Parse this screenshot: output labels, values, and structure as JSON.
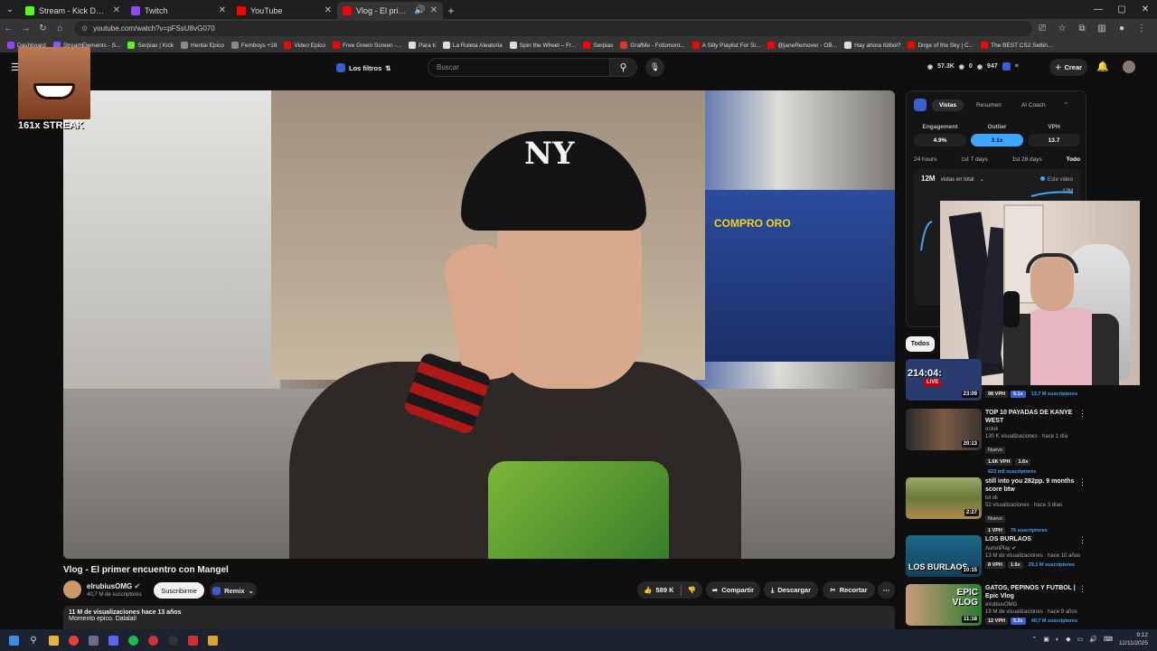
{
  "browser": {
    "tabs": [
      {
        "title": "Stream - Kick Dashboard",
        "color": "#53fc18",
        "active": false
      },
      {
        "title": "Twitch",
        "color": "#9146ff",
        "active": false
      },
      {
        "title": "YouTube",
        "color": "#ff0000",
        "active": false
      },
      {
        "title": "Vlog - El primer encuentro",
        "color": "#ff0000",
        "active": true
      }
    ],
    "url": "youtube.com/watch?v=pFSsU8vG070",
    "bookmarks": [
      {
        "label": "Dashboard",
        "color": "#9146ff"
      },
      {
        "label": "StreamElements - S...",
        "color": "#7a5cff"
      },
      {
        "label": "Serpias | Kick",
        "color": "#53fc18"
      },
      {
        "label": "Hentai Epico",
        "color": "#888888"
      },
      {
        "label": "Femboys +18",
        "color": "#888888"
      },
      {
        "label": "Video Epico",
        "color": "#ff0000"
      },
      {
        "label": "Free Green Screen -...",
        "color": "#ff0000"
      },
      {
        "label": "Para ti",
        "color": "#dddddd"
      },
      {
        "label": "La Ruleta Aleatoria",
        "color": "#dddddd"
      },
      {
        "label": "Spin the Wheel – Fr...",
        "color": "#dddddd"
      },
      {
        "label": "Serpias",
        "color": "#ff0000"
      },
      {
        "label": "GrafMe - Fotomont...",
        "color": "#dd3333"
      },
      {
        "label": "A Silly Playlist For Si...",
        "color": "#ff0000"
      },
      {
        "label": "@janeRemover - OB...",
        "color": "#ff0000"
      },
      {
        "label": "Hay ahora fútbol?",
        "color": "#dddddd"
      },
      {
        "label": "Dirge of the Sky | C...",
        "color": "#ff0000"
      },
      {
        "label": "The BEST CS2 Settin...",
        "color": "#ff0000"
      }
    ]
  },
  "header": {
    "filters_label": "Los filtros",
    "search_placeholder": "Buscar",
    "stat_views": "57.3K",
    "stat_zero": "0",
    "stat_count": "947",
    "create_label": "Crear"
  },
  "overlay": {
    "streak_label": "161x STREAK"
  },
  "video": {
    "cap_logo": "NY",
    "shop_sign": "COMPRO ORO",
    "title": "Vlog - El primer encuentro con Mangel",
    "channel": "elrubiusOMG",
    "subscribers": "40,7 M de suscriptores",
    "subscribe_label": "Suscribirme",
    "remix_label": "Remix",
    "likes": "589 K",
    "share_label": "Compartir",
    "download_label": "Descargar",
    "clip_label": "Recortar",
    "desc_line1": "11 M de visualizaciones  hace 13 años",
    "desc_line2": "Momento epico. Dalalai!"
  },
  "panel": {
    "tabs": [
      "Vistas",
      "Resumen",
      "AI Coach"
    ],
    "metrics": [
      {
        "label": "Engagement",
        "value": "4.9%"
      },
      {
        "label": "Outlier",
        "value": "3.1x"
      },
      {
        "label": "VPH",
        "value": "13.7"
      }
    ],
    "periods": [
      "24 hours",
      "1st 7 days",
      "1st 28 days",
      "Todo"
    ],
    "views_total": "12M",
    "views_sub": "vistas en total",
    "legend_label": "Este video",
    "chart_max_label": "12M"
  },
  "sidebar": {
    "filter_chip": "Todos",
    "recs": [
      {
        "title": "",
        "live_text": "214:04:",
        "live": "LIVE",
        "duration": "23:09",
        "vph": "98 VPH",
        "outlier": "5.1x",
        "subs": "13,7 M suscriptores",
        "color": "#2a3b70"
      },
      {
        "title": "TOP 10 PAYADAS DE KANYE WEST",
        "channel": "onlok",
        "stats": "130 K visualizaciones · hace 1 día",
        "badge": "Nuevo",
        "duration": "20:13",
        "vph": "1.6K VPH",
        "outlier": "1.6x",
        "subs": "623 mil suscriptores",
        "color": "#3c3530"
      },
      {
        "title": "still into you 282pp. 9 months score btw",
        "channel": "lol ok",
        "stats": "52 visualizaciones · hace 3 días",
        "badge": "Nuevo",
        "duration": "2:27",
        "vph": "1 VPH",
        "subs": "76 suscriptores",
        "color": "#6b7a3a"
      },
      {
        "title": "LOS BURLAOS",
        "channel": "AuronPlay",
        "stats": "13 M de visualizaciones · hace 10 años",
        "duration": "10:15",
        "vph": "8 VPH",
        "outlier": "1.6x",
        "subs": "29,1 M suscriptores",
        "thumb_text": "LOS BURLAOS",
        "color": "#15405a"
      },
      {
        "title": "GATOS, PEPINOS Y FUTBOL | Epic Vlog",
        "channel": "elrubiusOMG",
        "stats": "19 M de visualizaciones · hace 9 años",
        "duration": "11:18",
        "vph": "12 VPH",
        "outlier": "5.3x",
        "subs": "40,7 M suscriptores",
        "thumb_text": "EPIC VLOG",
        "color": "#2a7d2f"
      }
    ]
  },
  "taskbar": {
    "time": "9:12",
    "date": "12/11/2025"
  }
}
